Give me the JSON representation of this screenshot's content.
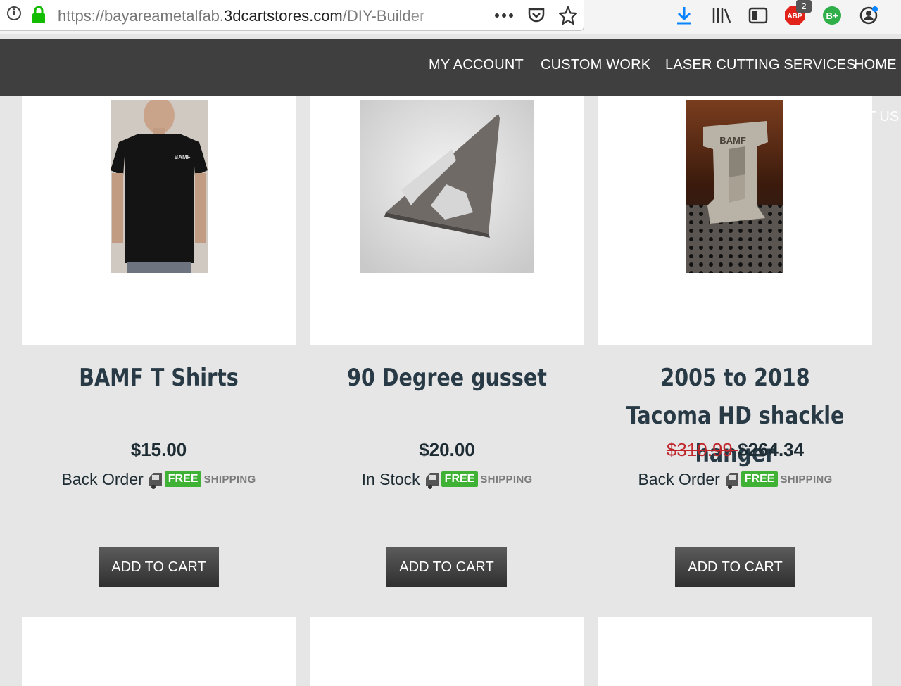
{
  "browser": {
    "url_prefix": "https://bayareametalfab.",
    "url_host": "3dcartstores.com",
    "url_path": "/DIY-Builder",
    "addon_badge_count": "2",
    "addon_abp_label": "ABP",
    "addon_bplus_label": "B+",
    "icons": [
      "info-icon",
      "lock-icon",
      "more-icon",
      "pocket-icon",
      "bookmark-star-icon",
      "download-icon",
      "library-icon",
      "sidebar-icon",
      "adblock-icon",
      "bplus-icon",
      "account-icon"
    ]
  },
  "nav": {
    "items": [
      "MY ACCOUNT",
      "CUSTOM WORK",
      "LASER CUTTING SERVICES",
      "HOME"
    ],
    "overflow_text": "T US"
  },
  "products": [
    {
      "title": "BAMF T Shirts",
      "price": "$15.00",
      "old_price": "",
      "stock": "Back Order",
      "free_label": "FREE",
      "shipping_label": "SHIPPING",
      "button": "ADD TO CART",
      "image_text": "BAMF"
    },
    {
      "title": "90 Degree gusset",
      "price": "$20.00",
      "old_price": "",
      "stock": "In Stock",
      "free_label": "FREE",
      "shipping_label": "SHIPPING",
      "button": "ADD TO CART",
      "image_text": ""
    },
    {
      "title": "2005 to 2018 Tacoma HD shackle hanger",
      "price": "$264.34",
      "old_price": "$310.99",
      "stock": "Back Order",
      "free_label": "FREE",
      "shipping_label": "SHIPPING",
      "button": "ADD TO CART",
      "image_text": "BAMF"
    }
  ],
  "colors": {
    "nav_bg": "#3f3f3f",
    "page_bg": "#e6e6e6",
    "title_color": "#283a45",
    "old_price_red": "#c0272d",
    "free_green": "#3fb236"
  }
}
